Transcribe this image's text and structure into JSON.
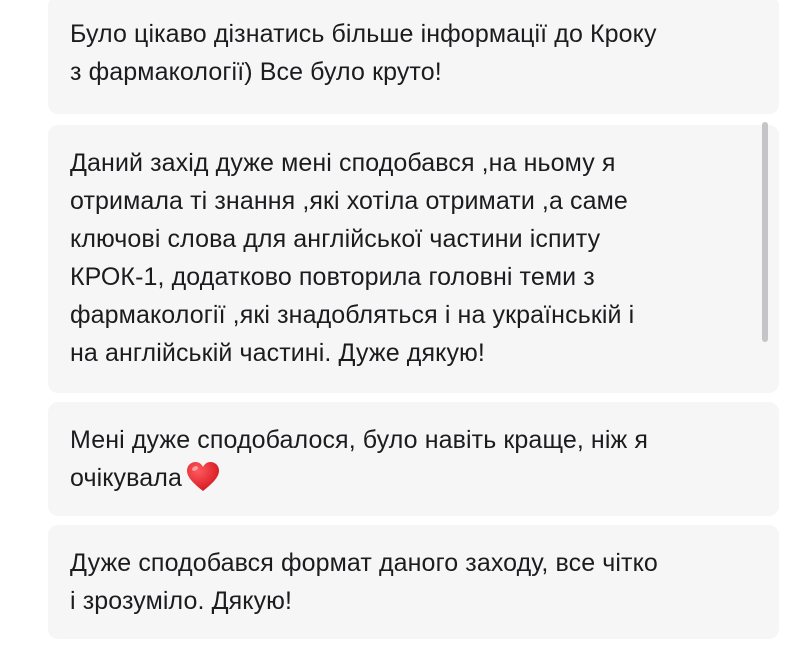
{
  "comments": [
    {
      "lines": [
        "Було цікаво дізнатись більше інформації до Кроку",
        "з фармакології) Все було круто!"
      ]
    },
    {
      "lines": [
        "Даний захід дуже мені сподобався ,на ньому я",
        "отримала ті знання ,які хотіла отримати ,а саме",
        "ключові слова для англійської частини іспиту",
        "КРОК-1, додатково повторила головні теми з",
        "фармакології ,які знадобляться і на українській і",
        "на англійській частині. Дуже дякую!"
      ]
    },
    {
      "lines": [
        "Мені дуже сподобалося, було навіть краще, ніж я",
        "очікувала"
      ],
      "emoji": "heart-icon",
      "emoji_color": "#e5242b"
    },
    {
      "lines": [
        "Дуже сподобався формат даного заходу, все чітко",
        "і зрозуміло. Дякую!"
      ]
    }
  ],
  "colors": {
    "card_background": "#f6f6f7",
    "text": "#1c1c1e",
    "scrollbar": "#c5c5c8"
  }
}
